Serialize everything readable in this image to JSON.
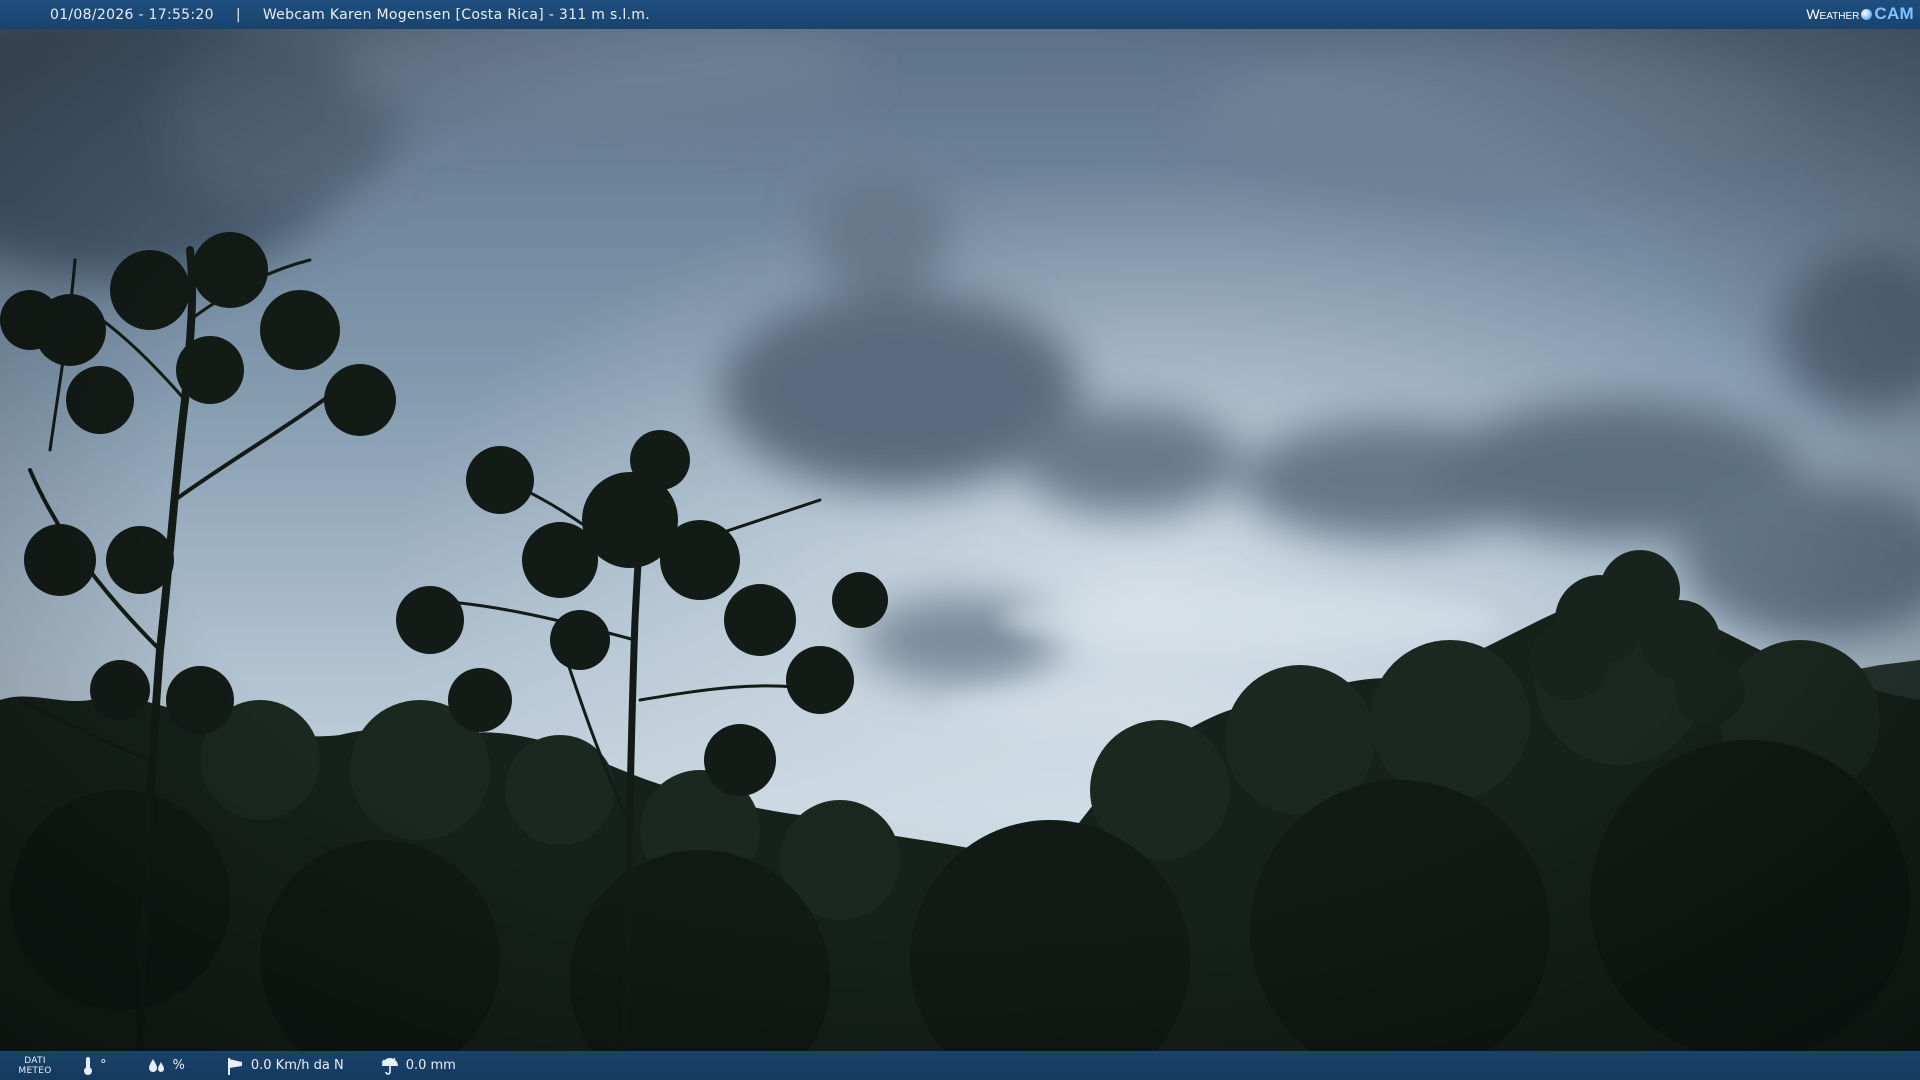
{
  "overlay_top": {
    "datetime": "01/08/2026 - 17:55:20",
    "separator": "|",
    "webcam_title": "Webcam Karen Mogensen [Costa Rica] - 311 m s.l.m.",
    "logo_weather": "Weather",
    "logo_cam": "CAM"
  },
  "overlay_bottom": {
    "dati_line1": "DATI",
    "dati_line2": "METEO",
    "temperature": "°",
    "humidity": "%",
    "wind": "0.0 Km/h da N",
    "rain": "0.0 mm"
  },
  "colors": {
    "bar_bg": "#1c4a78",
    "sky_light": "#c8d6e0",
    "sky_dark": "#3e5266",
    "foliage": "#15201a"
  },
  "icons": {
    "temperature": "thermometer-icon",
    "humidity": "droplets-icon",
    "wind": "windsock-icon",
    "rain": "umbrella-rain-icon",
    "logo_mark": "globe-dot-icon"
  }
}
